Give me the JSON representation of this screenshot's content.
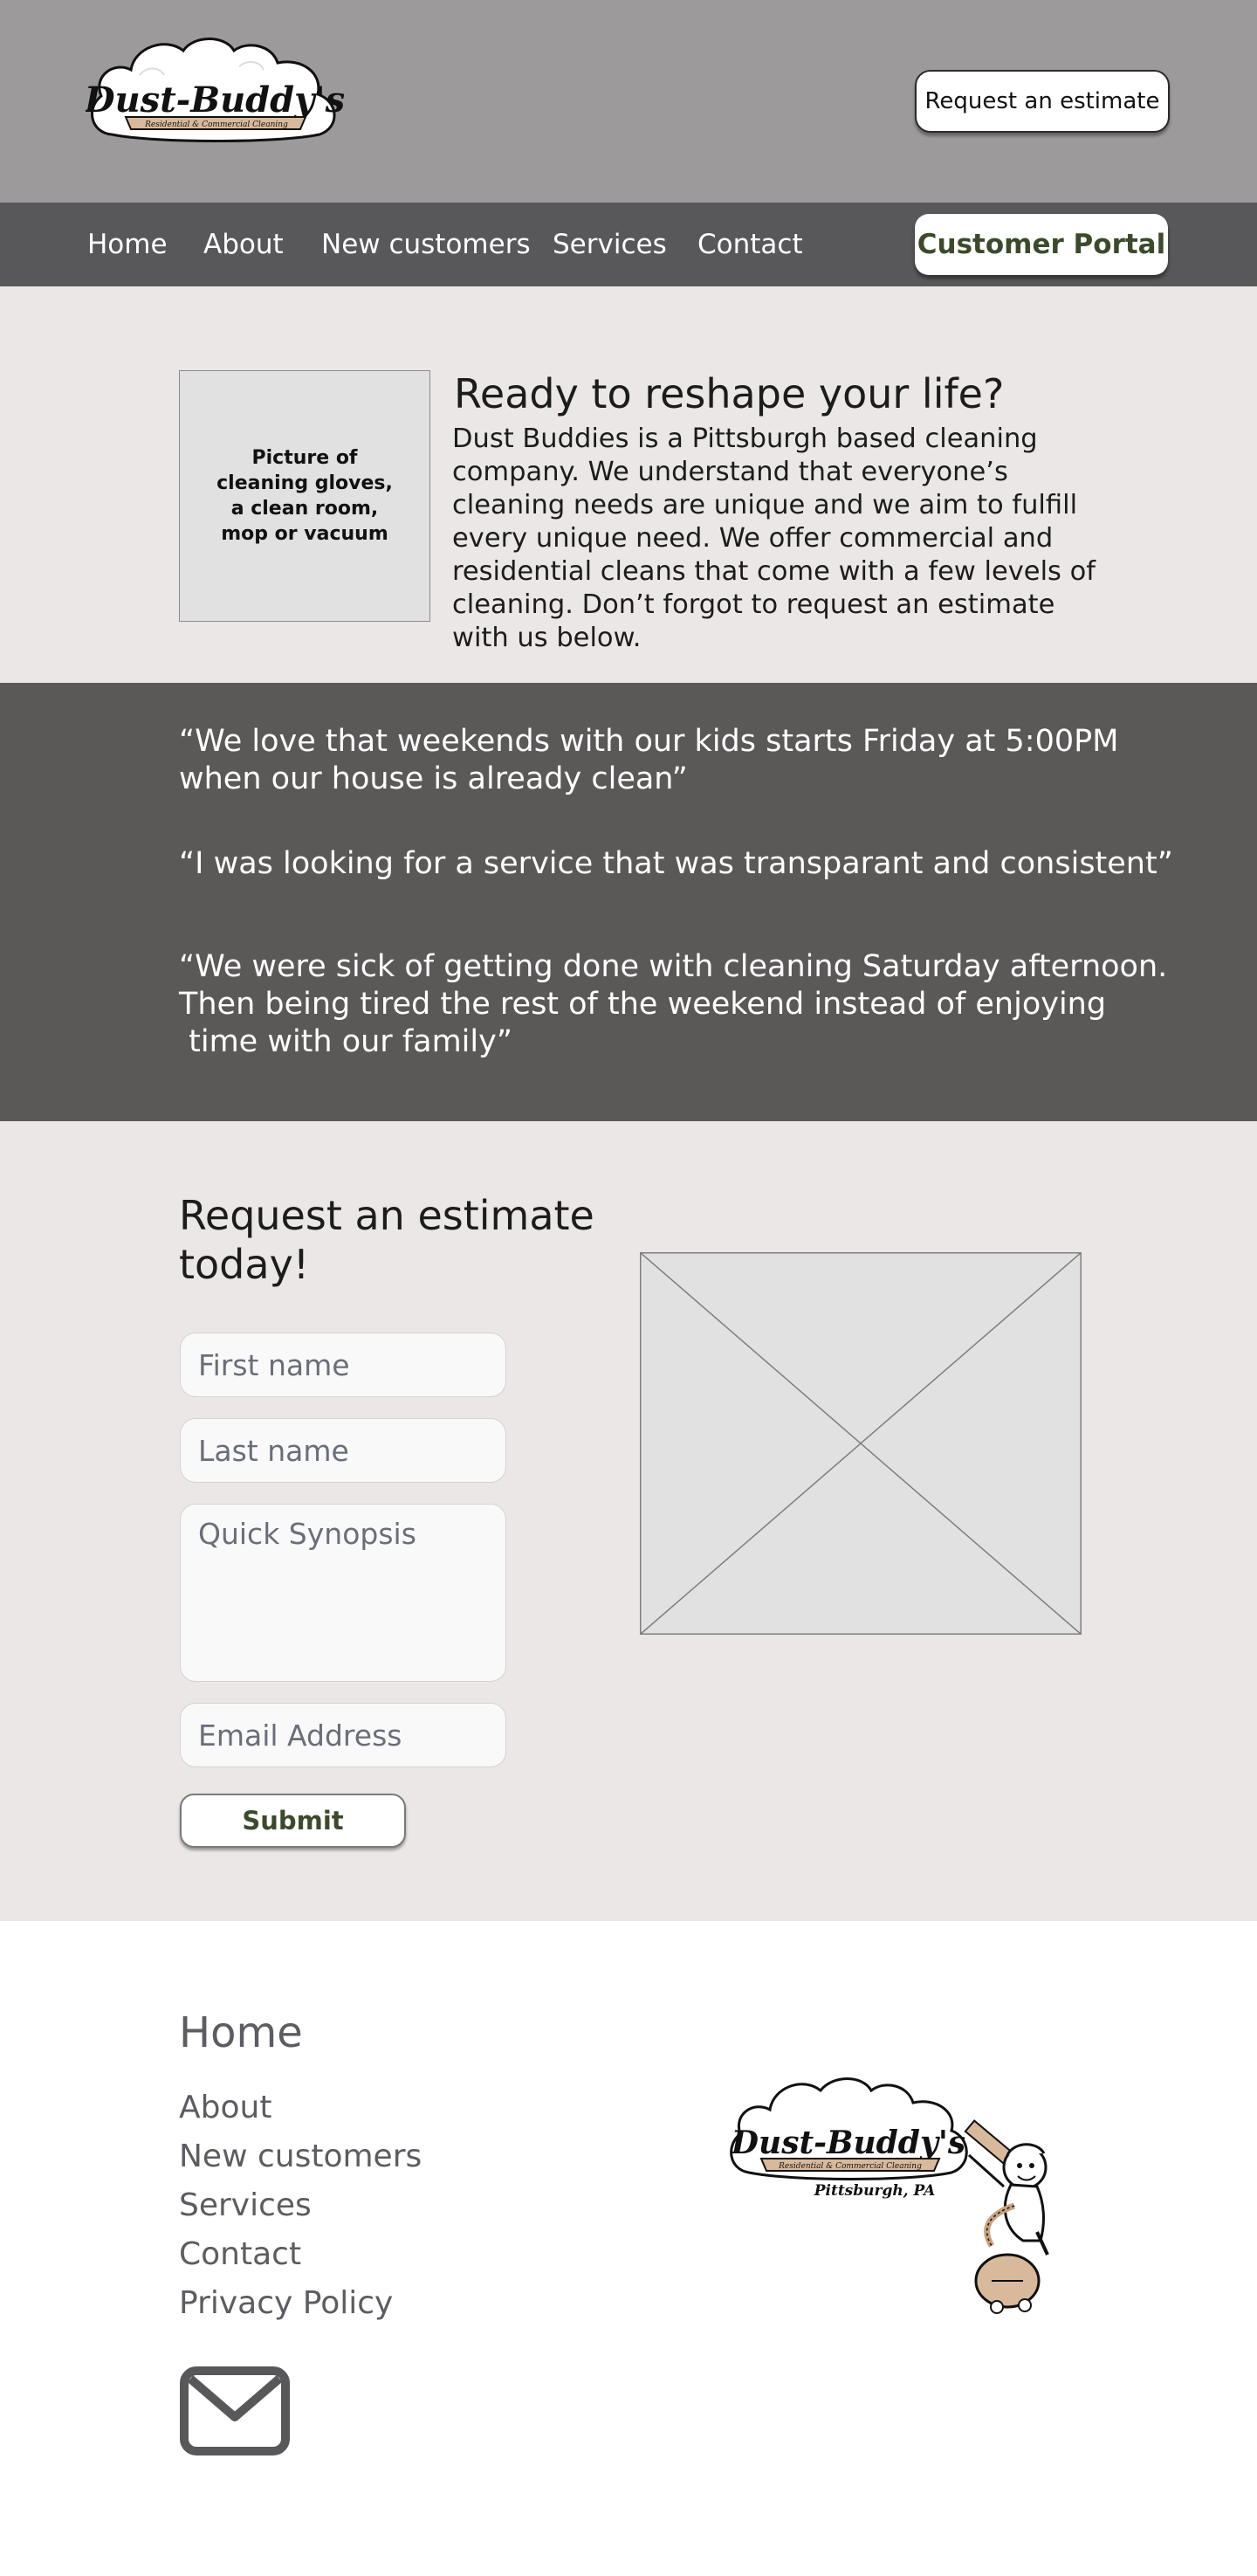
{
  "brand": {
    "logo_text": "Dust-Buddy's",
    "logo_banner": "Residential & Commercial Cleaning",
    "logo_location": "Pittsburgh, PA"
  },
  "header": {
    "estimate_button": "Request an estimate"
  },
  "nav": {
    "items": [
      {
        "label": "Home"
      },
      {
        "label": "About"
      },
      {
        "label": "New customers"
      },
      {
        "label": "Services"
      },
      {
        "label": "Contact"
      }
    ],
    "portal_button": "Customer Portal"
  },
  "intro": {
    "image_caption": "Picture of cleaning gloves,\na clean room,\nmop or vacuum",
    "title": "Ready to reshape your life?",
    "body": "Dust Buddies is a Pittsburgh based cleaning company. We understand that everyone’s cleaning needs are unique and we aim to fulfill every unique need. We offer commercial and residential cleans that come with a few levels of cleaning. Don’t forgot to request an estimate with us below."
  },
  "testimonials": [
    {
      "text": "“We love that weekends with our kids starts Friday at 5:00PM\nwhen our house is already clean”"
    },
    {
      "text": "“I was looking for a service that was transparant and consistent”"
    },
    {
      "text": "“We were sick of getting done with cleaning Saturday afternoon.\nThen being tired the rest of the weekend instead of enjoying\n time with our family”"
    }
  ],
  "estimate_form": {
    "title": "Request an estimate today!",
    "first_name_placeholder": "First name",
    "last_name_placeholder": "Last name",
    "synopsis_placeholder": "Quick Synopsis",
    "email_placeholder": "Email Address",
    "submit_label": "Submit"
  },
  "footer": {
    "home": "Home",
    "links": [
      {
        "label": "About"
      },
      {
        "label": "New customers"
      },
      {
        "label": "Services"
      },
      {
        "label": "Contact"
      },
      {
        "label": "Privacy Policy"
      }
    ],
    "mail_icon": "envelope-icon"
  },
  "colors": {
    "header_bg": "#9c9a9a",
    "nav_bg": "#58585a",
    "section_bg": "#ebe7e6",
    "testimonial_bg": "#5b5858",
    "accent_text": "#3c4a2c",
    "footer_text": "#5c5c62"
  }
}
